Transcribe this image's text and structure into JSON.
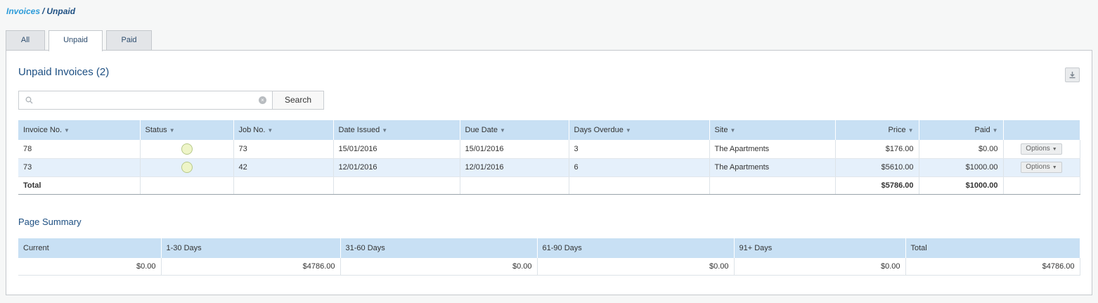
{
  "breadcrumb": {
    "parent": "Invoices",
    "separator": "/",
    "current": "Unpaid"
  },
  "tabs": [
    {
      "label": "All",
      "active": false
    },
    {
      "label": "Unpaid",
      "active": true
    },
    {
      "label": "Paid",
      "active": false
    }
  ],
  "panel": {
    "title": "Unpaid Invoices (2)",
    "download_icon": "download-icon"
  },
  "search": {
    "value": "",
    "placeholder": "",
    "button_label": "Search"
  },
  "invoices": {
    "columns": [
      "Invoice No.",
      "Status",
      "Job No.",
      "Date Issued",
      "Due Date",
      "Days Overdue",
      "Site",
      "Price",
      "Paid"
    ],
    "rows": [
      {
        "invoice_no": "78",
        "status": "unpaid",
        "job_no": "73",
        "date_issued": "15/01/2016",
        "due_date": "15/01/2016",
        "days_overdue": "3",
        "site": "The Apartments",
        "price": "$176.00",
        "paid": "$0.00",
        "options": "Options"
      },
      {
        "invoice_no": "73",
        "status": "unpaid",
        "job_no": "42",
        "date_issued": "12/01/2016",
        "due_date": "12/01/2016",
        "days_overdue": "6",
        "site": "The Apartments",
        "price": "$5610.00",
        "paid": "$1000.00",
        "options": "Options"
      }
    ],
    "total": {
      "label": "Total",
      "price": "$5786.00",
      "paid": "$1000.00"
    }
  },
  "summary": {
    "title": "Page Summary",
    "columns": [
      "Current",
      "1-30 Days",
      "31-60 Days",
      "61-90 Days",
      "91+ Days",
      "Total"
    ],
    "values": [
      "$0.00",
      "$4786.00",
      "$0.00",
      "$0.00",
      "$0.00",
      "$4786.00"
    ]
  },
  "colors": {
    "accent": "#1d4f82",
    "link": "#2b9bd9",
    "header_bg": "#c8e0f4",
    "alt_row": "#e5f0fb",
    "status_unpaid": "#eef5c8"
  }
}
